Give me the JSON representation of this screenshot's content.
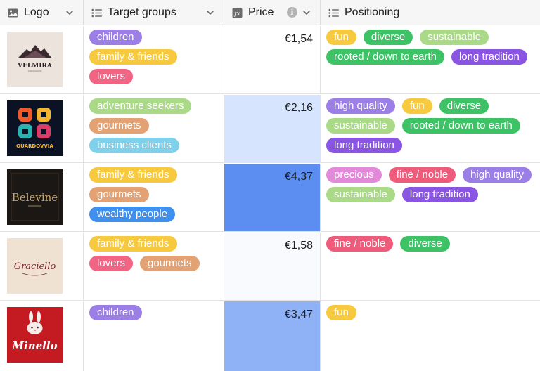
{
  "columns": {
    "logo": "Logo",
    "target": "Target groups",
    "price": "Price",
    "positioning": "Positioning"
  },
  "icons": {
    "logo_col": "image-icon",
    "target_col": "list-icon",
    "price_col": "formula-icon",
    "positioning_col": "list-icon",
    "price_info": "info-icon",
    "dropdown": "chevron-down-icon"
  },
  "tag_colors": {
    "purple": "#9b7ee6",
    "yellow": "#f7c93e",
    "pink": "#f16483",
    "lightgreen": "#aad987",
    "orange": "#e2a273",
    "skyblue": "#7fd0ea",
    "blue": "#3f8fee",
    "green": "#3ec266",
    "violet": "#8a55e2",
    "magenta": "#e389d9",
    "red": "#ee5b7b"
  },
  "price_highlights": {
    "row2": "#d6e5fd",
    "row3": "#5b8ef0",
    "row4": "#f8fafe",
    "row5": "#8fb1f6"
  },
  "rows": [
    {
      "logo_text": "VELMIRA",
      "logo_subtext": "CIOCCOLATO",
      "target_groups": [
        {
          "label": "children",
          "color": "purple"
        },
        {
          "label": "family & friends",
          "color": "yellow"
        },
        {
          "label": "lovers",
          "color": "pink"
        }
      ],
      "price": "€1,54",
      "positioning": [
        {
          "label": "fun",
          "color": "yellow"
        },
        {
          "label": "diverse",
          "color": "green"
        },
        {
          "label": "sustainable",
          "color": "lightgreen"
        },
        {
          "label": "rooted / down to earth",
          "color": "green"
        },
        {
          "label": "long tradition",
          "color": "violet"
        }
      ]
    },
    {
      "logo_text": "QUARDOVVIA",
      "target_groups": [
        {
          "label": "adventure seekers",
          "color": "lightgreen"
        },
        {
          "label": "gourmets",
          "color": "orange"
        },
        {
          "label": "business clients",
          "color": "skyblue"
        }
      ],
      "price": "€2,16",
      "positioning": [
        {
          "label": "high quality",
          "color": "purple"
        },
        {
          "label": "fun",
          "color": "yellow"
        },
        {
          "label": "diverse",
          "color": "green"
        },
        {
          "label": "sustainable",
          "color": "lightgreen"
        },
        {
          "label": "rooted / down to earth",
          "color": "green"
        },
        {
          "label": "long tradition",
          "color": "violet"
        }
      ]
    },
    {
      "logo_text": "Belevine",
      "target_groups": [
        {
          "label": "family & friends",
          "color": "yellow"
        },
        {
          "label": "gourmets",
          "color": "orange"
        },
        {
          "label": "wealthy people",
          "color": "blue"
        }
      ],
      "price": "€4,37",
      "positioning": [
        {
          "label": "precious",
          "color": "magenta"
        },
        {
          "label": "fine / noble",
          "color": "red"
        },
        {
          "label": "high quality",
          "color": "purple"
        },
        {
          "label": "sustainable",
          "color": "lightgreen"
        },
        {
          "label": "long tradition",
          "color": "violet"
        }
      ]
    },
    {
      "logo_text": "Graciello",
      "target_groups": [
        {
          "label": "family & friends",
          "color": "yellow"
        },
        {
          "label": "lovers",
          "color": "pink"
        },
        {
          "label": "gourmets",
          "color": "orange"
        }
      ],
      "price": "€1,58",
      "positioning": [
        {
          "label": "fine / noble",
          "color": "red"
        },
        {
          "label": "diverse",
          "color": "green"
        }
      ]
    },
    {
      "logo_text": "Minello",
      "target_groups": [
        {
          "label": "children",
          "color": "purple"
        }
      ],
      "price": "€3,47",
      "positioning": [
        {
          "label": "fun",
          "color": "yellow"
        }
      ]
    }
  ]
}
